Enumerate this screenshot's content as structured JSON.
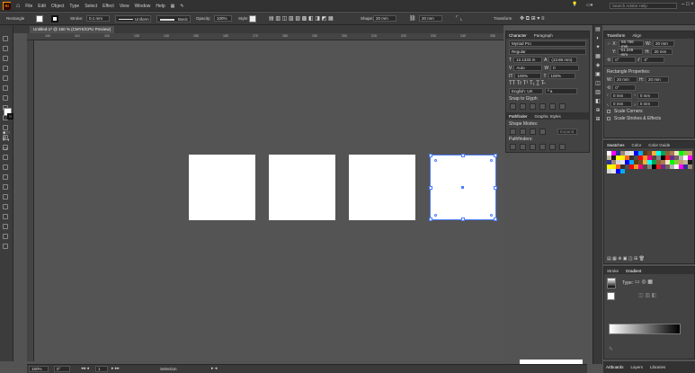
{
  "app": {
    "logo": "Ai"
  },
  "menu": [
    "File",
    "Edit",
    "Object",
    "Type",
    "Select",
    "Effect",
    "View",
    "Window",
    "Help"
  ],
  "search_placeholder": "Search Adobe Help",
  "control": {
    "object_type": "Rectangle",
    "stroke_label": "Stroke:",
    "stroke_value": "0.1 mm",
    "stroke_profile": "Uniform",
    "brush": "Basic",
    "opacity_label": "Opacity:",
    "opacity_value": "100%",
    "style_label": "Style:",
    "shape_label": "Shape:",
    "shape_w": "20 mm",
    "shape_h": "20 mm",
    "transform_label": "Transform"
  },
  "document_tab": "Untitled-1* @ 150 % (CMYK/CPU Preview)",
  "ruler_marks": [
    "100",
    "110",
    "120",
    "130",
    "140",
    "150",
    "160",
    "170",
    "180",
    "190",
    "200",
    "210",
    "220",
    "230",
    "240",
    "250"
  ],
  "character_panel": {
    "tabs": [
      "Character",
      "Paragraph"
    ],
    "font_search": "Myriad Pro",
    "style": "Regular",
    "size": "12.1333 m",
    "leading": "(13.86 mm)",
    "kerning": "Auto",
    "tracking": "0",
    "v_scale": "100%",
    "h_scale": "100%",
    "language": "English: UK",
    "aa": "ª a",
    "snap_label": "Snap to Glyph"
  },
  "pathfinder_panel": {
    "tabs": [
      "Pathfinder",
      "Graphic Styles"
    ],
    "shape_modes": "Shape Modes:",
    "expand": "Expand",
    "pathfinders": "Pathfinders:"
  },
  "transform_panel": {
    "tabs": [
      "Transform",
      "Align"
    ],
    "x": "65.766 mm",
    "y": "51.249 mm",
    "w": "20 mm",
    "h": "20 mm",
    "angle": "0°",
    "shear": "0°",
    "rect_props": "Rectangle Properties:",
    "rect_w": "20 mm",
    "rect_h": "20 mm",
    "rot": "0°",
    "corner1": "0 mm",
    "corner2": "0 mm",
    "corner3": "0 mm",
    "corner4": "0 mm",
    "scale_corners": "Scale Corners",
    "scale_strokes": "Scale Strokes & Effects"
  },
  "swatches_panel": {
    "tabs": [
      "Swatches",
      "Color",
      "Color Guide"
    ]
  },
  "stroke_gradient_panel": {
    "tabs": [
      "Stroke",
      "Gradient"
    ],
    "type_label": "Type:"
  },
  "bottom_tabs": [
    "Artboards",
    "Layers",
    "Libraries"
  ],
  "status": {
    "zoom": "150%",
    "angle": "0°",
    "artboard": "1",
    "tool": "Selection"
  },
  "colors": {
    "accent": "#4a7cff",
    "artboard": "#ffffff",
    "canvas": "#545454"
  }
}
